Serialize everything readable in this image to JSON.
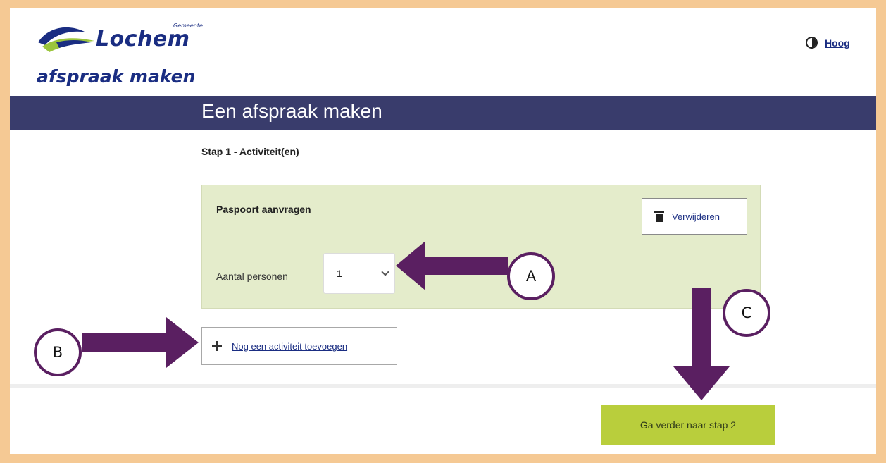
{
  "header": {
    "logo_municipality": "Gemeente",
    "logo_name": "Lochem",
    "logo_subtitle": "afspraak maken",
    "contrast_link": "Hoog"
  },
  "banner": {
    "title": "Een afspraak maken"
  },
  "step": {
    "label": "Stap 1 - Activiteit(en)"
  },
  "activity": {
    "title": "Paspoort aanvragen",
    "delete_label": "Verwijderen",
    "persons_label": "Aantal personen",
    "persons_value": "1"
  },
  "add_activity": {
    "label": "Nog een activiteit toevoegen"
  },
  "next": {
    "label": "Ga verder naar stap 2"
  },
  "annotations": {
    "a": "A",
    "b": "B",
    "c": "C"
  },
  "colors": {
    "frame": "#f5c994",
    "banner": "#393c6c",
    "card": "#e4eccb",
    "primary_button": "#b9ce3c",
    "annotation": "#5a1f61",
    "link": "#1a2d82"
  }
}
